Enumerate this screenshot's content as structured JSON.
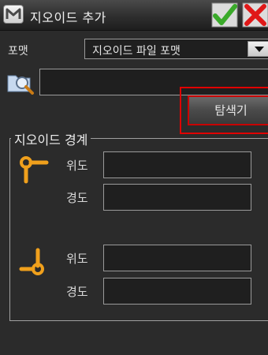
{
  "titlebar": {
    "title": "지오이드 추가",
    "app_logo": "app-logo-icon",
    "ok_icon": "checkmark-icon",
    "cancel_icon": "close-icon"
  },
  "format": {
    "label": "포맷",
    "value": "지오이드 파일 포맷"
  },
  "file": {
    "path_value": "",
    "browse_icon": "folder-search-icon"
  },
  "explorer_button": {
    "label": "탐색기"
  },
  "boundary": {
    "title": "지오이드 경계",
    "northwest": {
      "icon": "corner-top-left-icon",
      "lat_label": "위도",
      "lon_label": "경도",
      "lat_value": "",
      "lon_value": ""
    },
    "southeast": {
      "icon": "corner-bottom-right-icon",
      "lat_label": "위도",
      "lon_label": "경도",
      "lat_value": "",
      "lon_value": ""
    }
  },
  "colors": {
    "accent_orange": "#f0a01c",
    "ok_green": "#3aaa2a",
    "cancel_red": "#e01818",
    "highlight_red": "#e00000"
  }
}
